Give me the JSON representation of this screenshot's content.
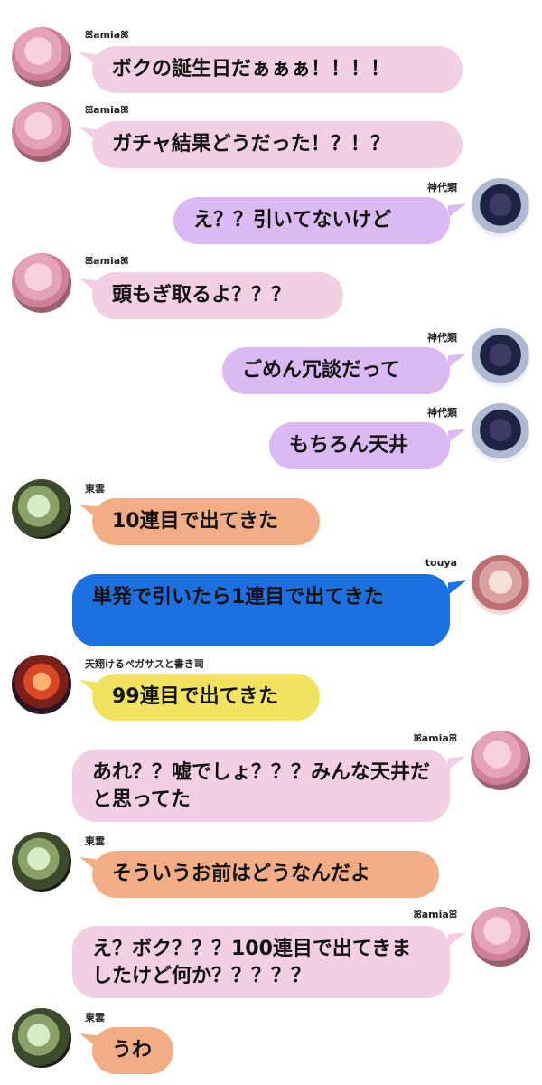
{
  "users": {
    "mizuki": {
      "name": "ꕤamiaꕤ"
    },
    "rui": {
      "name": "神代類"
    },
    "shinonome": {
      "name": "東雲"
    },
    "touya": {
      "name": "touya"
    },
    "tsukasa": {
      "name": "天翔けるペガサスと書き司"
    }
  },
  "messages": [
    {
      "text": "ボクの誕生日だぁぁぁ！！！！"
    },
    {
      "text": "ガチャ結果どうだった！？！？"
    },
    {
      "text": "え？？引いてないけど"
    },
    {
      "text": "頭もぎ取るよ？？？"
    },
    {
      "text": "ごめん冗談だって"
    },
    {
      "text": "もちろん天井"
    },
    {
      "text": "10連目で出てきた"
    },
    {
      "text": "単発で引いたら1連目で出てきた"
    },
    {
      "text": "99連目で出てきた"
    },
    {
      "text": "あれ？？嘘でしょ？？？みんな天井だと思ってた"
    },
    {
      "text": "そういうお前はどうなんだよ"
    },
    {
      "text": "え？ボク？？？100連目で出てきましたけど何か？？？？？"
    },
    {
      "text": "うわ"
    }
  ],
  "colors": {
    "pink": "#f2cfe3",
    "purple": "#dbb9f2",
    "orange": "#f3ad85",
    "blue": "#1d70e0",
    "yellow": "#f1e35f"
  },
  "icons": [
    "avatar-mizuki",
    "avatar-rui",
    "avatar-shinonome",
    "avatar-touya",
    "avatar-tsukasa"
  ]
}
